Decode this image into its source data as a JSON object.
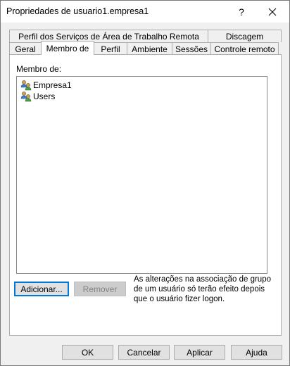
{
  "window": {
    "title": "Propriedades de usuario1.empresa1",
    "help_glyph": "?"
  },
  "tabs_row1": [
    {
      "label": "Perfil dos Serviços de Área de Trabalho Remota"
    },
    {
      "label": "Discagem"
    }
  ],
  "tabs_row2": [
    {
      "label": "Geral"
    },
    {
      "label": "Membro de",
      "active": true
    },
    {
      "label": "Perfil"
    },
    {
      "label": "Ambiente"
    },
    {
      "label": "Sessões"
    },
    {
      "label": "Controle remoto"
    }
  ],
  "panel": {
    "membro_label": "Membro de:",
    "members": [
      {
        "name": "Empresa1",
        "icon": "group-icon"
      },
      {
        "name": "Users",
        "icon": "group-icon"
      }
    ],
    "add_button": "Adicionar...",
    "remove_button": "Remover",
    "note_text": "As alterações na associação de grupo de um usuário só terão efeito depois que o usuário fizer logon."
  },
  "footer": {
    "ok": "OK",
    "cancel": "Cancelar",
    "apply": "Aplicar",
    "help": "Ajuda"
  },
  "colors": {
    "focus": "#0078d7",
    "window_bg": "#f0f0f0"
  }
}
